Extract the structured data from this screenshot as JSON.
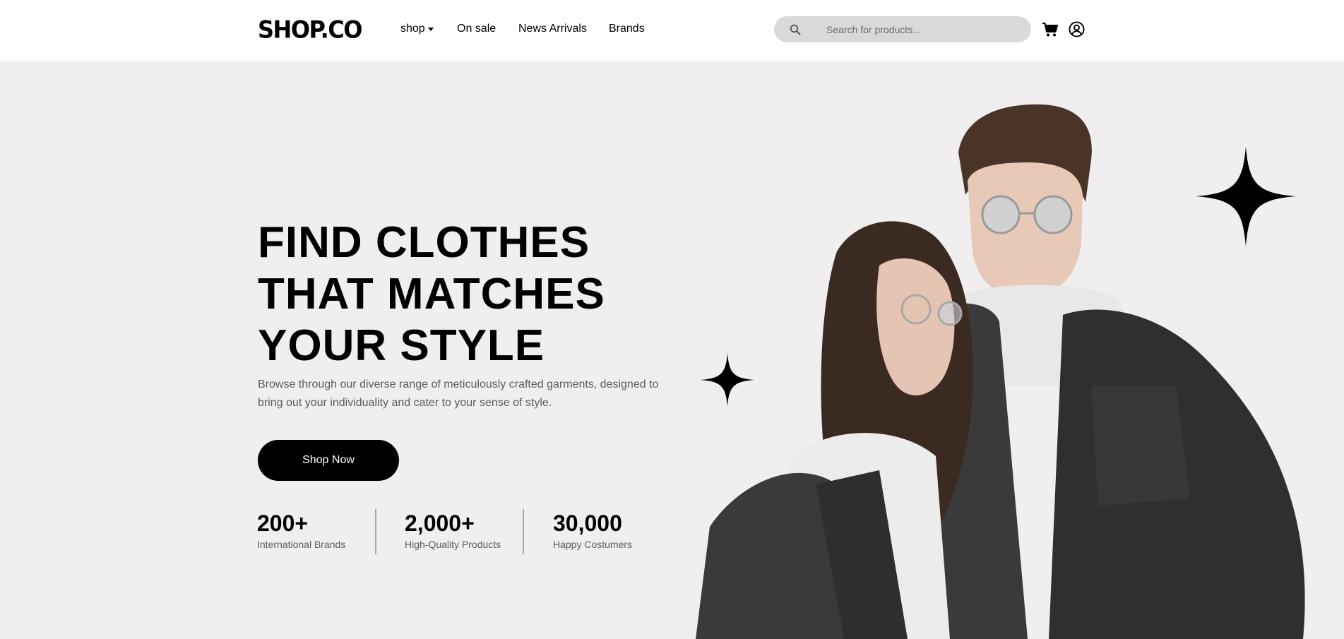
{
  "brand": {
    "logo": "SHOP.CO"
  },
  "nav": {
    "shop": "shop",
    "on_sale": "On sale",
    "news_arrivals": "News Arrivals",
    "brands": "Brands"
  },
  "search": {
    "placeholder": "Search for products...",
    "value": ""
  },
  "icons": {
    "search": "search-icon",
    "cart": "cart-icon",
    "account": "user-circle-icon",
    "caret": "caret-down-icon",
    "sparkle": "sparkle-star-icon"
  },
  "hero": {
    "headline": [
      "FIND CLOTHES",
      "THAT MATCHES",
      "YOUR STYLE"
    ],
    "description": "Browse through our diverse range of meticulously crafted garments, designed to bring out your individuality and cater to your sense of style.",
    "cta": "Shop Now",
    "stats": [
      {
        "value": "200+",
        "label": "International Brands"
      },
      {
        "value": "2,000+",
        "label": "High-Quality Products"
      },
      {
        "value": "30,000",
        "label": "Happy Costumers"
      }
    ]
  },
  "colors": {
    "hero_background": "#f0eeef",
    "button": "#000000",
    "search_background": "#d9d9d9",
    "muted_text": "#5c5c5c"
  }
}
